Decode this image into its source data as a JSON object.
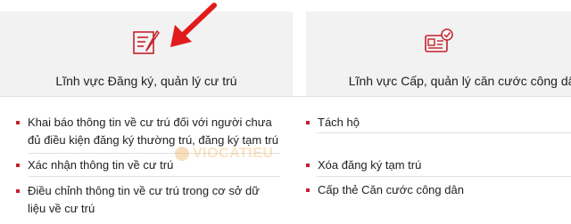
{
  "cards": {
    "left": {
      "icon": "form-edit-icon",
      "title": "Lĩnh vực Đăng ký, quản lý cư trú"
    },
    "right": {
      "icon": "id-card-check-icon",
      "title": "Lĩnh vực Cấp, quản lý căn cước công dân"
    }
  },
  "lists": {
    "left": [
      "Khai báo thông tin về cư trú đối với người chưa đủ điều kiện đăng ký thường trú, đăng ký tạm trú",
      "Xác nhận thông tin về cư trú",
      "Điều chỉnh thông tin về cư trú trong cơ sở dữ liệu về cư trú"
    ],
    "right": [
      "Tách hộ",
      "Xóa đăng ký tạm trú",
      "Cấp thẻ Căn cước công dân"
    ]
  },
  "watermark": "VIOCATIEU",
  "colors": {
    "accent": "#c8202a",
    "card_bg": "#f2f2f2",
    "arrow": "#e11b1b"
  }
}
